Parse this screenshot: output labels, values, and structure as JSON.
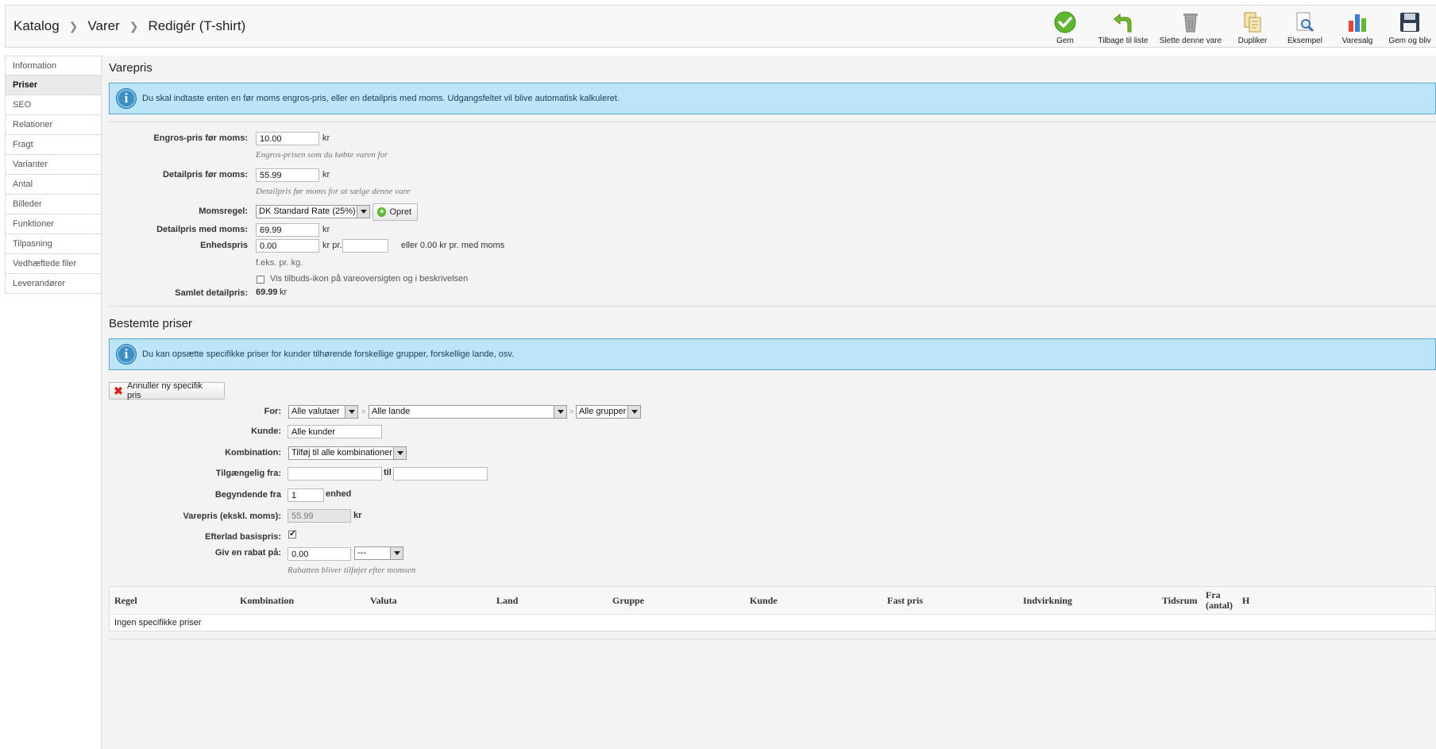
{
  "breadcrumb": {
    "level1": "Katalog",
    "sep": ">",
    "level2": "Varer",
    "level3": "Redigér (T-shirt)"
  },
  "toolbar": {
    "save": "Gem",
    "back": "Tilbage til liste",
    "delete": "Slette denne vare",
    "duplicate": "Dupliker",
    "preview": "Eksempel",
    "sales": "Varesalg",
    "save_stay": "Gem og bliv"
  },
  "sidebar": {
    "items": [
      {
        "label": "Information"
      },
      {
        "label": "Priser"
      },
      {
        "label": "SEO"
      },
      {
        "label": "Relationer"
      },
      {
        "label": "Fragt"
      },
      {
        "label": "Varianter"
      },
      {
        "label": "Antal"
      },
      {
        "label": "Billeder"
      },
      {
        "label": "Funktioner"
      },
      {
        "label": "Tilpasning"
      },
      {
        "label": "Vedhæftede filer"
      },
      {
        "label": "Leverandører"
      }
    ],
    "active_index": 1
  },
  "varepris": {
    "title": "Varepris",
    "info": "Du skal indtaste enten en før moms engros-pris, eller en detailpris med moms. Udgangsfeltet vil blive automatisk kalkuleret.",
    "wholesale_label": "Engros-pris før moms:",
    "wholesale_value": "10.00",
    "wholesale_unit": "kr",
    "wholesale_hint": "Engros-prisen som du købte varen for",
    "retail_label": "Detailpris før moms:",
    "retail_value": "55.99",
    "retail_unit": "kr",
    "retail_hint": "Detailpris før moms for at sælge denne vare",
    "tax_label": "Momsregel:",
    "tax_value": "DK Standard Rate (25%)",
    "create_button": "Opret",
    "retail_tax_label": "Detailpris med moms:",
    "retail_tax_value": "69.99",
    "retail_tax_unit": "kr",
    "unit_label": "Enhedspris",
    "unit_value": "0.00",
    "unit_per": "kr pr.",
    "unit_per_value": "",
    "unit_or": "eller 0.00 kr pr. med moms",
    "unit_hint": "f.eks. pr. kg.",
    "offer_checkbox": "Vis tilbuds-ikon på vareoversigten og i beskrivelsen",
    "total_label": "Samlet detailpris:",
    "total_value": "69.99",
    "total_unit": "kr"
  },
  "specific": {
    "title": "Bestemte priser",
    "info": "Du kan opsætte specifikke priser for kunder tilhørende forskellige grupper, forskellige lande, osv.",
    "cancel_button": "Annuller ny specifik pris",
    "for_label": "For:",
    "currency": "Alle valutaer",
    "country": "Alle lande",
    "group": "Alle grupper",
    "customer_label": "Kunde:",
    "customer_value": "Alle kunder",
    "combination_label": "Kombination:",
    "combination_value": "Tilføj til alle kombinationer",
    "available_label": "Tilgængelig fra:",
    "available_from": "",
    "to_label": "til",
    "available_to": "",
    "starting_label": "Begyndende fra",
    "starting_value": "1",
    "starting_unit": "enhed",
    "price_label": "Varepris (ekskl. moms):",
    "price_value": "55.99",
    "price_unit": "kr",
    "leave_base_label": "Efterlad basispris:",
    "leave_base_checked": true,
    "discount_label": "Giv en rabat på:",
    "discount_value": "0.00",
    "discount_type": "---",
    "discount_hint": "Rabatten bliver tilføjet efter momsen"
  },
  "table": {
    "headers": {
      "rule": "Regel",
      "combination": "Kombination",
      "currency": "Valuta",
      "country": "Land",
      "group": "Gruppe",
      "customer": "Kunde",
      "fixed_price": "Fast pris",
      "impact": "Indvirkning",
      "period": "Tidsrum",
      "from_qty": "Fra (antal)",
      "h": "H"
    },
    "empty": "Ingen specifikke priser"
  }
}
